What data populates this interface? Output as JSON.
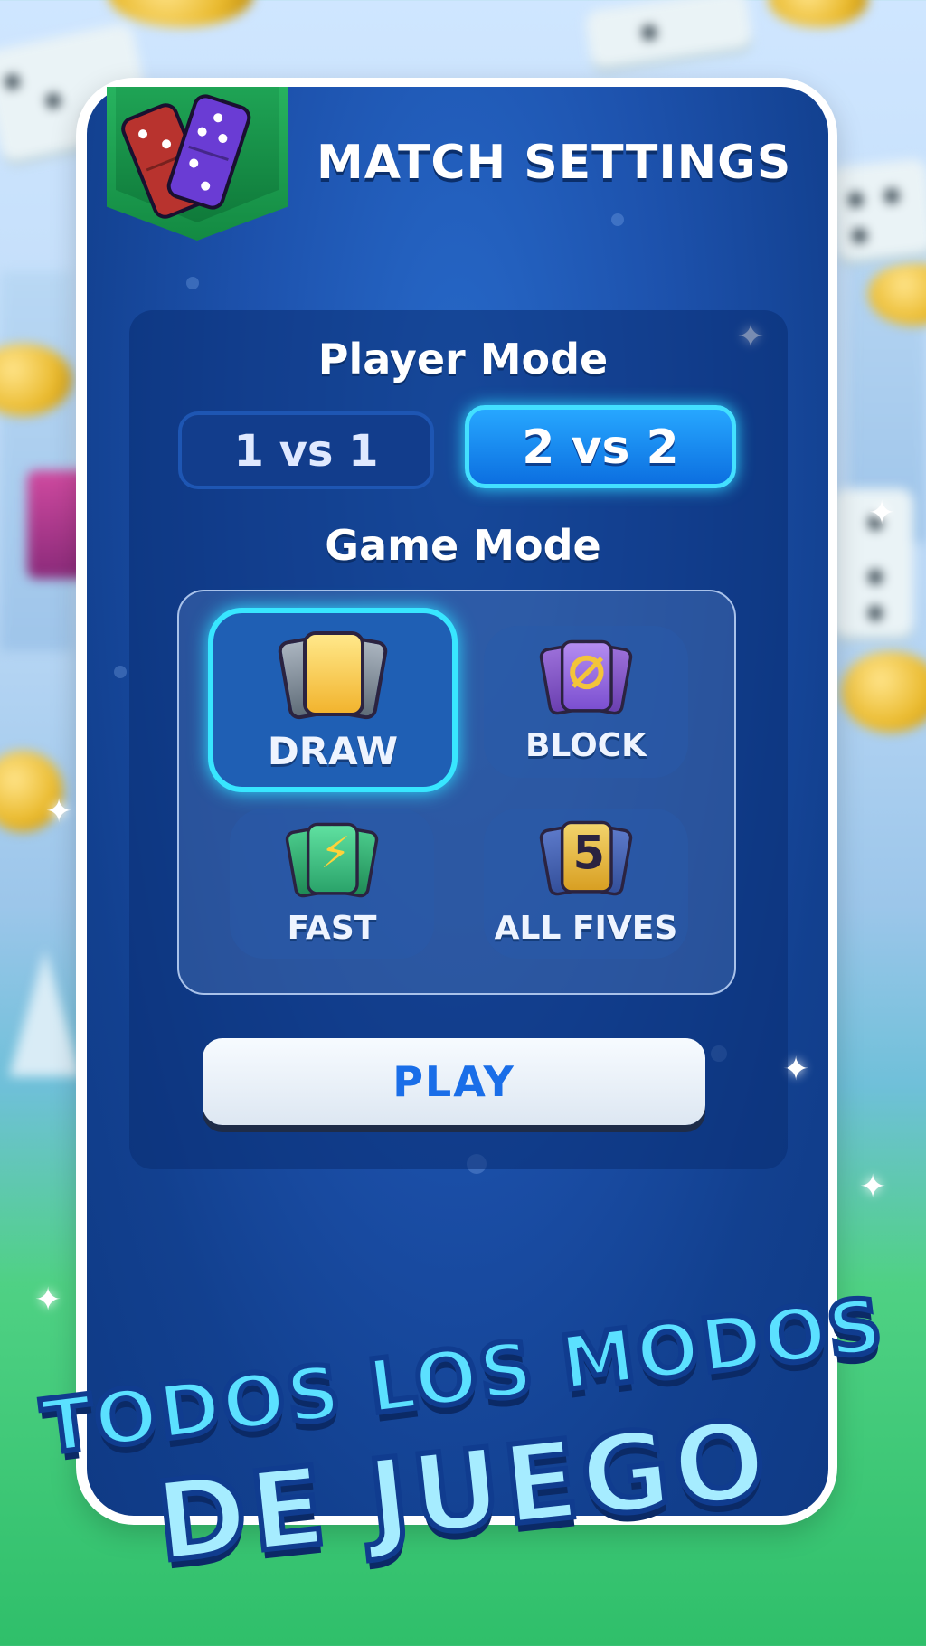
{
  "header": {
    "title": "MATCH SETTINGS",
    "badge_icon": "dominoes-icon"
  },
  "player_mode": {
    "label": "Player Mode",
    "options": [
      {
        "label": "1 vs 1",
        "selected": false
      },
      {
        "label": "2 vs 2",
        "selected": true
      }
    ]
  },
  "game_mode": {
    "label": "Game Mode",
    "options": [
      {
        "label": "DRAW",
        "icon": "draw-cards-icon",
        "selected": true
      },
      {
        "label": "BLOCK",
        "icon": "block-cards-icon",
        "selected": false
      },
      {
        "label": "FAST",
        "icon": "fast-lightning-icon",
        "selected": false
      },
      {
        "label": "ALL FIVES",
        "icon": "all-fives-icon",
        "selected": false
      }
    ]
  },
  "play_button": {
    "label": "PLAY"
  },
  "promo": {
    "line1": "TODOS LOS MODOS",
    "line2": "DE JUEGO"
  },
  "colors": {
    "accent_cyan": "#38e6ff",
    "panel_blue": "#1d52ad",
    "play_text": "#1a6ee8",
    "badge_green": "#1fa455"
  }
}
